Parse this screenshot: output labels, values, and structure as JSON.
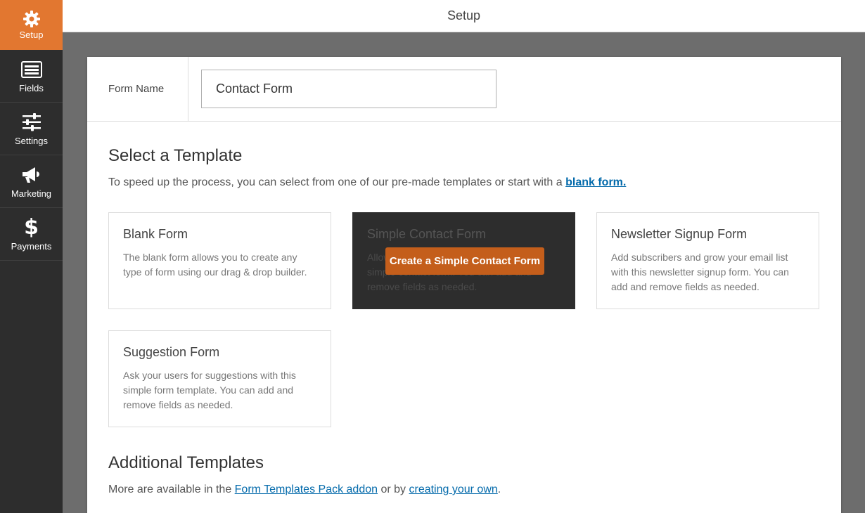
{
  "sidebar": {
    "items": [
      {
        "label": "Setup",
        "icon": "gear-icon",
        "active": true
      },
      {
        "label": "Fields",
        "icon": "list-icon",
        "active": false
      },
      {
        "label": "Settings",
        "icon": "sliders-icon",
        "active": false
      },
      {
        "label": "Marketing",
        "icon": "megaphone-icon",
        "active": false
      },
      {
        "label": "Payments",
        "icon": "dollar-icon",
        "active": false
      }
    ]
  },
  "header": {
    "title": "Setup"
  },
  "form_name": {
    "label": "Form Name",
    "value": "Contact Form"
  },
  "templates": {
    "title": "Select a Template",
    "desc_prefix": "To speed up the process, you can select from one of our pre-made templates or start with a ",
    "desc_link": "blank form.",
    "cards": [
      {
        "title": "Blank Form",
        "desc": "The blank form allows you to create any type of form using our drag & drop builder."
      },
      {
        "title": "Simple Contact Form",
        "desc": "Allow your users to contact you with this simple contact form. You can add and remove fields as needed.",
        "button": "Create a Simple Contact Form"
      },
      {
        "title": "Newsletter Signup Form",
        "desc": "Add subscribers and grow your email list with this newsletter signup form. You can add and remove fields as needed."
      },
      {
        "title": "Suggestion Form",
        "desc": "Ask your users for suggestions with this simple form template. You can add and remove fields as needed."
      }
    ]
  },
  "additional": {
    "title": "Additional Templates",
    "prefix": "More are available in the ",
    "link1": "Form Templates Pack addon",
    "middle": " or by ",
    "link2": "creating your own",
    "suffix": "."
  },
  "colors": {
    "accent": "#e27730",
    "sidebar": "#2d2d2d",
    "button": "#c45e1b",
    "link": "#036aab"
  }
}
